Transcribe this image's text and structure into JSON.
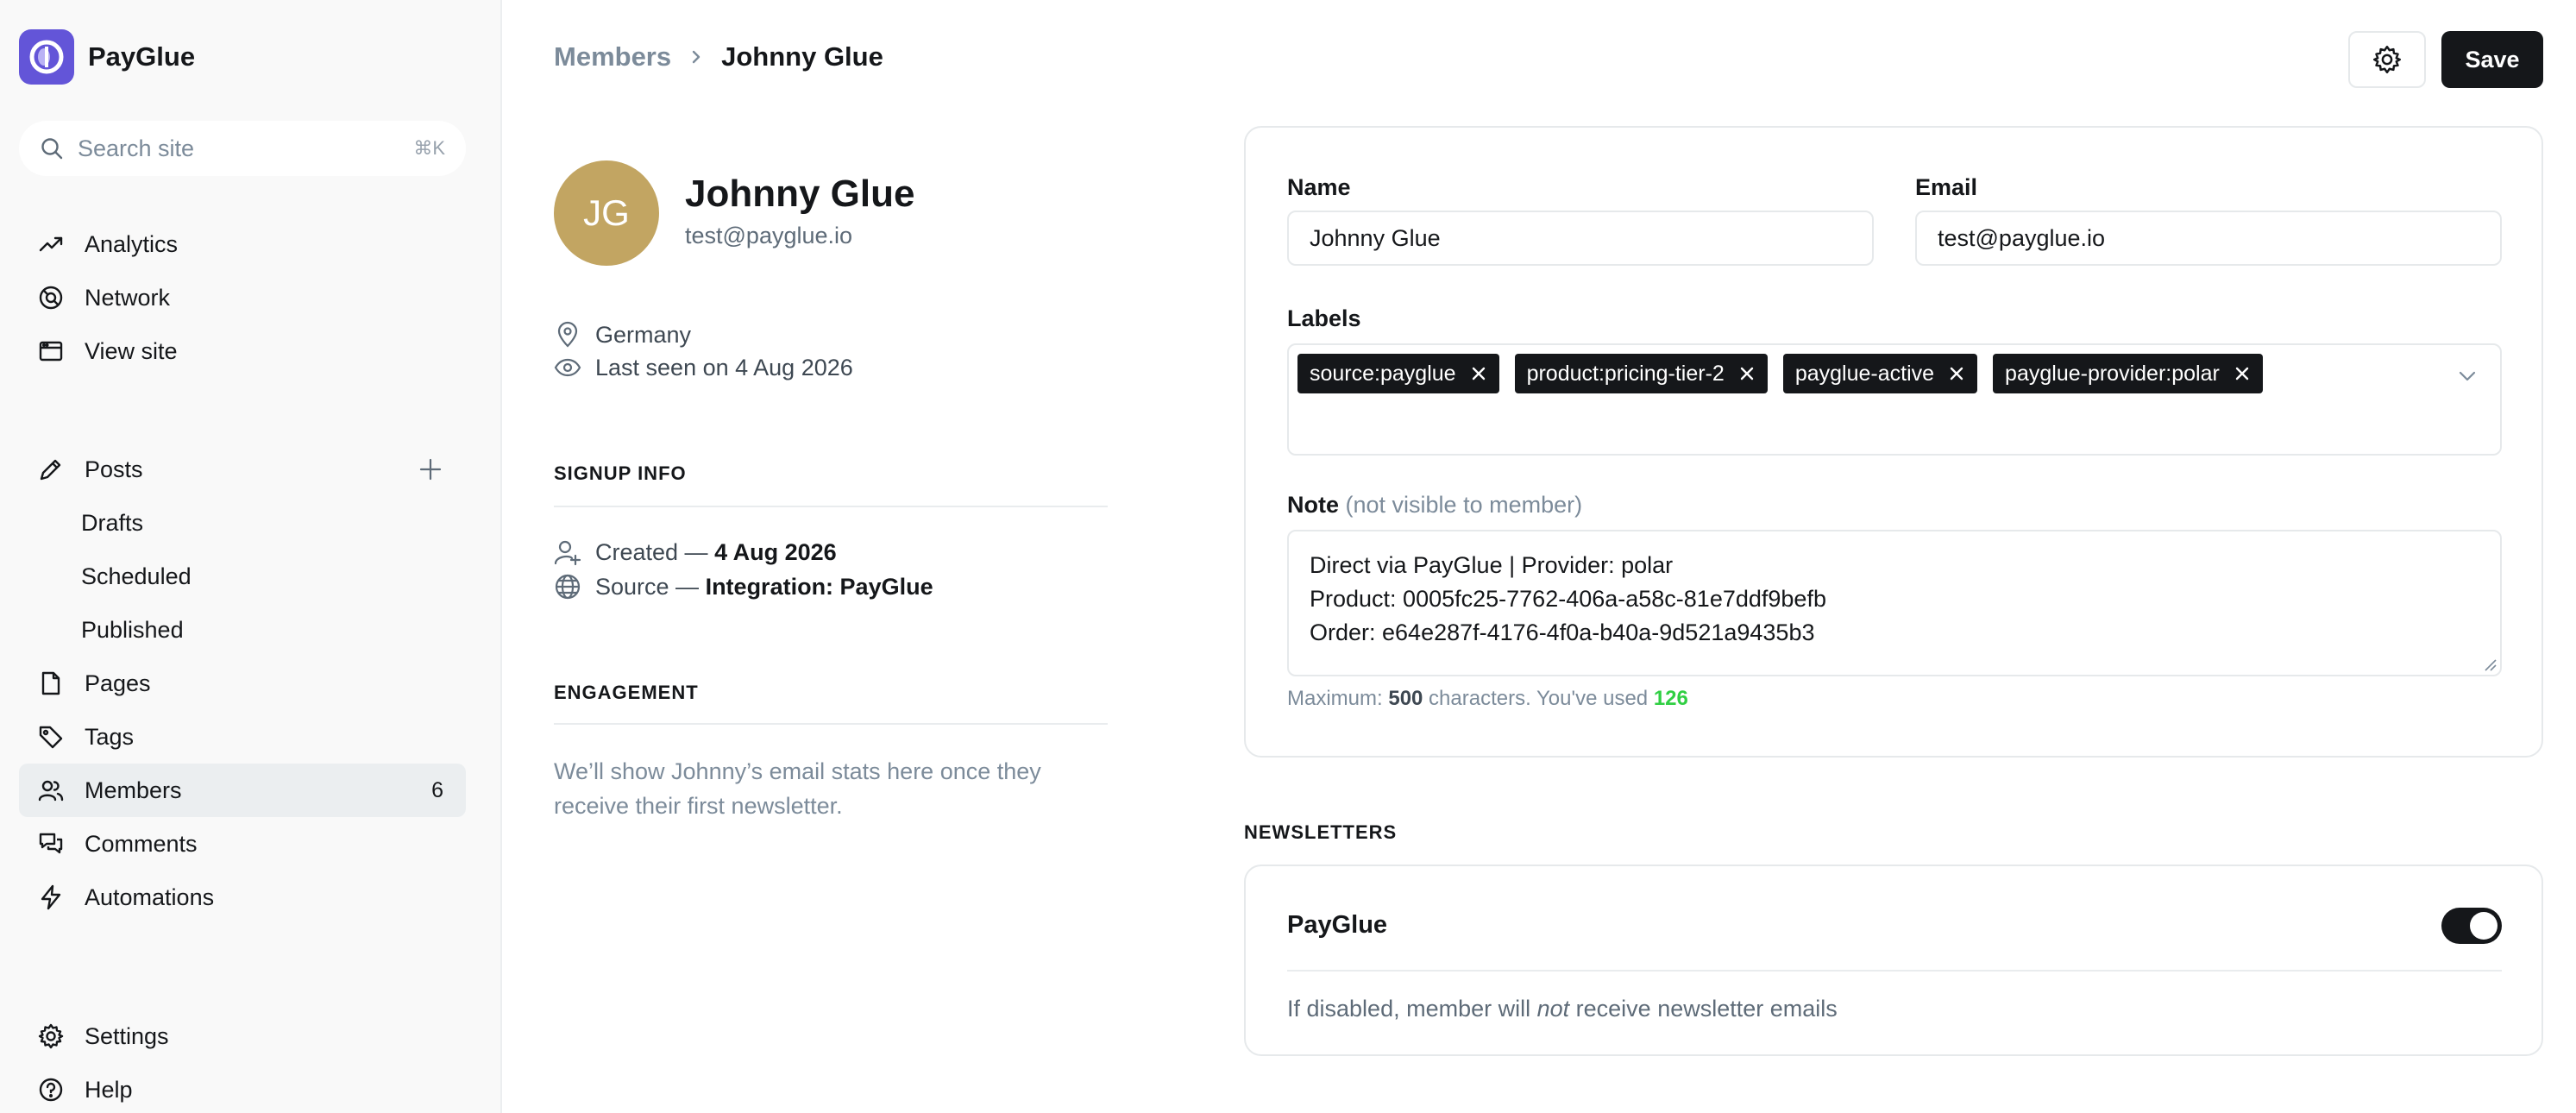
{
  "app": {
    "name": "PayGlue"
  },
  "search": {
    "placeholder": "Search site",
    "shortcut": "⌘K"
  },
  "sidebar": {
    "top_items": [
      {
        "label": "Analytics",
        "icon": "trend-up-icon"
      },
      {
        "label": "Network",
        "icon": "network-icon"
      },
      {
        "label": "View site",
        "icon": "browser-window-icon"
      }
    ],
    "posts": {
      "label": "Posts",
      "icon": "pen-icon",
      "sub_items": [
        "Drafts",
        "Scheduled",
        "Published"
      ]
    },
    "content_items": [
      {
        "label": "Pages",
        "icon": "page-icon"
      },
      {
        "label": "Tags",
        "icon": "tag-icon"
      },
      {
        "label": "Members",
        "icon": "users-icon",
        "count": "6",
        "active": true
      },
      {
        "label": "Comments",
        "icon": "comments-icon"
      },
      {
        "label": "Automations",
        "icon": "lightning-icon"
      }
    ],
    "bottom_items": [
      {
        "label": "Settings",
        "icon": "gear-icon"
      },
      {
        "label": "Help",
        "icon": "help-icon"
      }
    ]
  },
  "breadcrumb": {
    "parent": "Members",
    "current": "Johnny Glue"
  },
  "header": {
    "save_label": "Save"
  },
  "member": {
    "initials": "JG",
    "name": "Johnny Glue",
    "email": "test@payglue.io",
    "location": "Germany",
    "last_seen": "Last seen on 4 Aug 2026"
  },
  "signup": {
    "title": "SIGNUP INFO",
    "created_prefix": "Created — ",
    "created_value": "4 Aug 2026",
    "source_prefix": "Source — ",
    "source_value": "Integration: PayGlue"
  },
  "engagement": {
    "title": "ENGAGEMENT",
    "text": "We’ll show Johnny’s email stats here once they receive their first newsletter."
  },
  "form": {
    "name_label": "Name",
    "name_value": "Johnny Glue",
    "email_label": "Email",
    "email_value": "test@payglue.io",
    "labels_label": "Labels",
    "labels": [
      "source:payglue",
      "product:pricing-tier-2",
      "payglue-active",
      "payglue-provider:polar"
    ],
    "note_label": "Note",
    "note_hint": "(not visible to member)",
    "note_lines": [
      "Direct via PayGlue | Provider: polar",
      "Product: 0005fc25-7762-406a-a58c-81e7ddf9befb",
      "Order: e64e287f-4176-4f0a-b40a-9d521a9435b3"
    ],
    "limit_prefix": "Maximum: ",
    "limit_max": "500",
    "limit_middle": " characters. You've used ",
    "limit_used": "126"
  },
  "newsletters": {
    "title": "NEWSLETTERS",
    "name": "PayGlue",
    "enabled": true,
    "desc_before": "If disabled, member will ",
    "desc_em": "not",
    "desc_after": " receive newsletter emails"
  },
  "colors": {
    "brand": "#6355d8",
    "avatar": "#c2a562",
    "primary": "#15171a",
    "success": "#30cf43",
    "muted": "#7c8b9a"
  }
}
